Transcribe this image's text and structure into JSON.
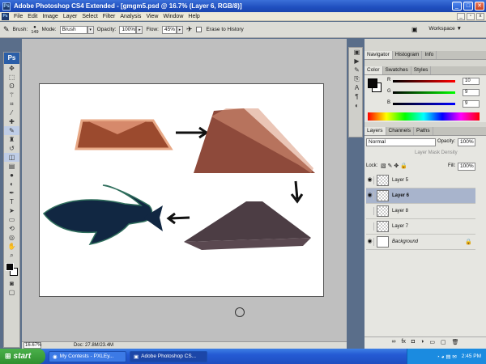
{
  "window": {
    "title": "Adobe Photoshop CS4 Extended - [gmgm5.psd @ 16.7% (Layer 6, RGB/8)]"
  },
  "menu": {
    "items": [
      "File",
      "Edit",
      "Image",
      "Layer",
      "Select",
      "Filter",
      "Analysis",
      "View",
      "Window",
      "Help"
    ]
  },
  "options": {
    "brush_label": "Brush:",
    "brush_size": "149",
    "mode_label": "Mode:",
    "mode_value": "Brush",
    "opacity_label": "Opacity:",
    "opacity_value": "100%",
    "flow_label": "Flow:",
    "flow_value": "45%",
    "erase_history_label": "Erase to History",
    "workspace_label": "Workspace"
  },
  "status": {
    "zoom": "16.67%",
    "doc": "Doc: 27.8M/23.4M"
  },
  "panels": {
    "navigator_tabs": [
      "Navigator",
      "Histogram",
      "Info"
    ],
    "color_tabs": [
      "Color",
      "Swatches",
      "Styles"
    ],
    "color": {
      "r_label": "R",
      "g_label": "G",
      "b_label": "B",
      "r": "10",
      "g": "9",
      "b": "9"
    },
    "layers_tabs": [
      "Layers",
      "Channels",
      "Paths"
    ],
    "blend_mode": "Normal",
    "opacity_label": "Opacity:",
    "opacity": "100%",
    "mask_density_label": "Layer Mask Density",
    "lock_label": "Lock:",
    "fill_label": "Fill:",
    "fill": "100%",
    "layers": [
      {
        "name": "Layer 5",
        "visible": true,
        "selected": false
      },
      {
        "name": "Layer 6",
        "visible": true,
        "selected": true
      },
      {
        "name": "Layer 8",
        "visible": false,
        "selected": false
      },
      {
        "name": "Layer 7",
        "visible": false,
        "selected": false
      },
      {
        "name": "Background",
        "visible": true,
        "selected": false
      }
    ]
  },
  "taskbar": {
    "start_label": "start",
    "items": [
      "My Contests - PXLEy...",
      "Adobe Photoshop CS..."
    ],
    "clock": "2:45 PM"
  },
  "colors": {
    "foreground": "#0a0909",
    "background": "#ffffff",
    "selection": "#a8b4cc"
  },
  "icons": [
    "brush-tool-icon",
    "move-tool-icon",
    "marquee-tool-icon",
    "lasso-tool-icon",
    "wand-tool-icon",
    "crop-tool-icon",
    "eyedropper-tool-icon",
    "healing-tool-icon",
    "brush-icon",
    "stamp-tool-icon",
    "history-brush-icon",
    "eraser-tool-icon",
    "gradient-tool-icon",
    "blur-tool-icon",
    "dodge-tool-icon",
    "pen-tool-icon",
    "type-tool-icon",
    "path-select-icon",
    "shape-tool-icon",
    "3d-rotate-icon",
    "hand-tool-icon",
    "zoom-tool-icon",
    "eye-icon",
    "lock-icon",
    "link-icon",
    "fx-icon",
    "mask-icon",
    "new-layer-icon",
    "trash-icon"
  ]
}
